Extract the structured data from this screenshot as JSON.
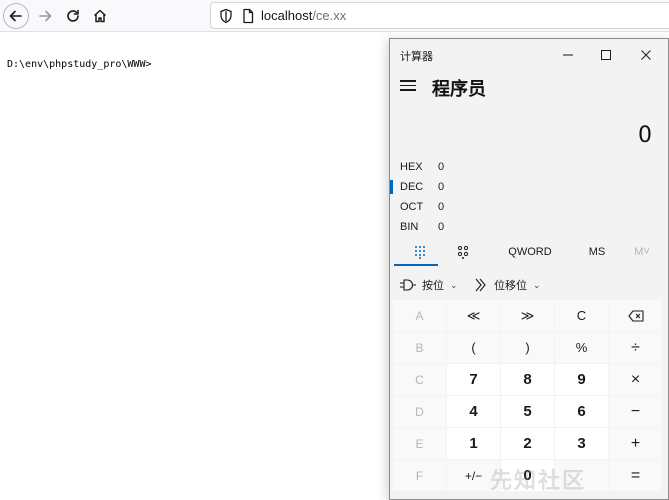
{
  "browser": {
    "url_host": "localhost",
    "url_path": "/ce.xx"
  },
  "page": {
    "content_text": "D:\\env\\phpstudy_pro\\WWW>"
  },
  "calculator": {
    "window_title": "计算器",
    "mode": "程序员",
    "display": "0",
    "bases": [
      {
        "name": "HEX",
        "value": "0"
      },
      {
        "name": "DEC",
        "value": "0"
      },
      {
        "name": "OCT",
        "value": "0"
      },
      {
        "name": "BIN",
        "value": "0"
      }
    ],
    "tabs": {
      "word": "QWORD",
      "ms": "MS",
      "mplus": "M˅"
    },
    "dropdowns": {
      "bitwise": "按位",
      "bitshift": "位移位"
    },
    "keys": [
      [
        "A",
        "≪",
        "≫",
        "C",
        "⌫"
      ],
      [
        "B",
        "(",
        ")",
        "%",
        "÷"
      ],
      [
        "C",
        "7",
        "8",
        "9",
        "×"
      ],
      [
        "D",
        "4",
        "5",
        "6",
        "−"
      ],
      [
        "E",
        "1",
        "2",
        "3",
        "+"
      ],
      [
        "F",
        "+/−",
        "0",
        ".",
        "="
      ]
    ],
    "accent_color": "#0067c0"
  },
  "watermark": "先知社区"
}
